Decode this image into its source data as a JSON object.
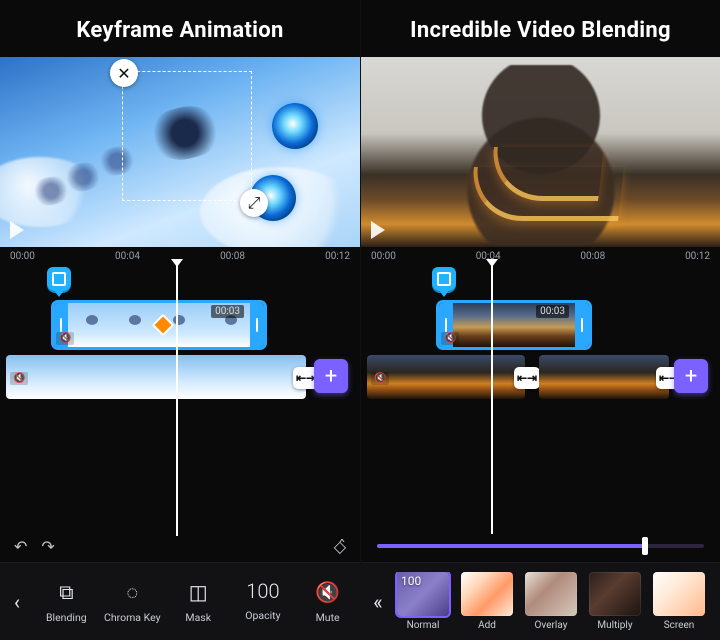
{
  "left": {
    "headline": "Keyframe Animation",
    "ruler": [
      "00:00",
      "00:04",
      "00:08",
      "00:12"
    ],
    "clip_time": "00:03",
    "toolbar": {
      "back_glyph": "‹",
      "items": [
        {
          "id": "blending",
          "label": "Blending",
          "glyph": "⧉"
        },
        {
          "id": "chromakey",
          "label": "Chroma Key",
          "glyph": "◌"
        },
        {
          "id": "mask",
          "label": "Mask",
          "glyph": "◫"
        },
        {
          "id": "opacity",
          "label": "Opacity",
          "value": "100"
        },
        {
          "id": "mute",
          "label": "Mute",
          "glyph": "🔇"
        }
      ]
    }
  },
  "right": {
    "headline": "Incredible Video Blending",
    "ruler": [
      "00:00",
      "00:04",
      "00:08",
      "00:12"
    ],
    "clip_time": "00:03",
    "slider_percent": 82,
    "modes": {
      "back_glyph": "«",
      "selected_value": "100",
      "items": [
        {
          "id": "normal",
          "label": "Normal"
        },
        {
          "id": "add",
          "label": "Add"
        },
        {
          "id": "overlay",
          "label": "Overlay"
        },
        {
          "id": "multiply",
          "label": "Multiply"
        },
        {
          "id": "screen",
          "label": "Screen"
        }
      ]
    }
  },
  "glyphs": {
    "close": "✕",
    "resize": "⤢",
    "play": "▶",
    "undo": "↶",
    "redo": "↷",
    "kf_toggle": "◇̂",
    "transition": "⇤⇥",
    "add": "+",
    "mute_small": "🔇"
  }
}
